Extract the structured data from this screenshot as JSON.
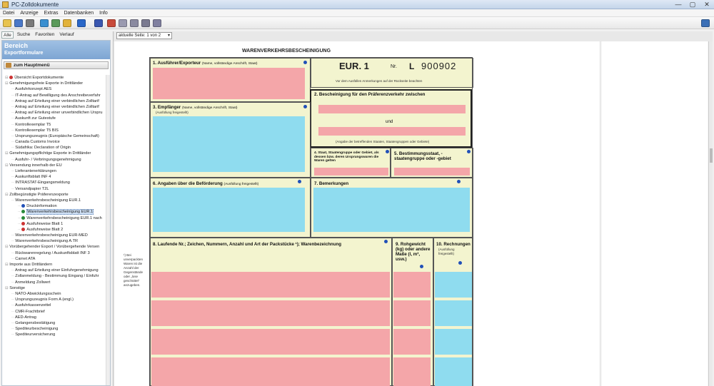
{
  "window": {
    "title": "PC-Zolldokumente",
    "controls": [
      "—",
      "▢",
      "✕"
    ]
  },
  "menu": [
    "Datei",
    "Anzeige",
    "Extras",
    "Datenbanken",
    "Info"
  ],
  "toolbar": {
    "colors": [
      "#e8c34f",
      "#4a78c8",
      "#7a7a7a",
      "#3a8fd0",
      "#5a9a5a",
      "#e2b23a",
      "#2a67c8",
      "#3a57b0",
      "#c84a3a",
      "#9a9ab0",
      "#8a8aa0",
      "#7a7a90",
      "#8080a0"
    ],
    "right_icon": "#3a6fb6"
  },
  "left_tabs": [
    "Alle",
    "Suche",
    "Favoriten",
    "Verlauf"
  ],
  "sidebar": {
    "title": "Bereich",
    "subtitle": "Exportformulare",
    "home_button": "zum Hauptmenü",
    "tree": [
      {
        "level": 1,
        "text": "Übersicht Exportdokumente",
        "icon": "#c33"
      },
      {
        "level": 1,
        "text": "Genehmigungsfreie Exporte in Drittländer"
      },
      {
        "level": 2,
        "text": "Ausfuhrkonzept AES"
      },
      {
        "level": 2,
        "text": "IT-Antrag auf Bewilligung des Anschreibeverfahr"
      },
      {
        "level": 2,
        "text": "Antrag auf Erteilung einer verbindlichen Zolltarif"
      },
      {
        "level": 2,
        "text": "Antrag auf Erteilung einer verbindlichen Zolltarif"
      },
      {
        "level": 2,
        "text": "Antrag auf Erteilung einer unverbindlichen Urspru"
      },
      {
        "level": 2,
        "text": "Auskunft zur Gutestufe"
      },
      {
        "level": 2,
        "text": "Kontrollexemplar T5"
      },
      {
        "level": 2,
        "text": "Kontrollexemplar T5 BIS"
      },
      {
        "level": 2,
        "text": "Ursprungszeugnis (Europäische Gemeinschaft)"
      },
      {
        "level": 2,
        "text": "Canada Customs Invoice"
      },
      {
        "level": 2,
        "text": "Südafrika: Declaration of Origin"
      },
      {
        "level": 1,
        "text": "Genehmigungspflichtige Exporte in Drittländer"
      },
      {
        "level": 2,
        "text": "Ausfuhr- / Verbringungsgenehmigung"
      },
      {
        "level": 1,
        "text": "Versendung innerhalb der EU"
      },
      {
        "level": 2,
        "text": "Lieferantenerklärungen"
      },
      {
        "level": 2,
        "text": "Auskunftsblatt INF 4"
      },
      {
        "level": 2,
        "text": "INTRASTAT-Eingangsmeldung"
      },
      {
        "level": 2,
        "text": "Versandpapier T2L"
      },
      {
        "level": 1,
        "text": "Zollbegünstigte Präferenzexporte"
      },
      {
        "level": 2,
        "text": "Warenverkehrsbescheinigung EUR.1"
      },
      {
        "level": 3,
        "text": "Druckinformation",
        "icon": "#2150b8"
      },
      {
        "level": 3,
        "text": "Warenverkehrsbescheinigung EUR.1",
        "icon": "#2a8a3a",
        "selected": true
      },
      {
        "level": 3,
        "text": "Warenverkehrsbescheinigung EUR.1 nach",
        "icon": "#2a8a3a"
      },
      {
        "level": 3,
        "text": "Ausfuhrweise Blatt 1",
        "icon": "#c33"
      },
      {
        "level": 3,
        "text": "Ausfuhrweise Blatt 2",
        "icon": "#c33"
      },
      {
        "level": 2,
        "text": "Warenverkehrsbescheinigung EUR-MED"
      },
      {
        "level": 2,
        "text": "Warenverkehrsbescheinigung A.TR"
      },
      {
        "level": 1,
        "text": "Vorübergehender Export / Vorübergehende Versen"
      },
      {
        "level": 2,
        "text": "Rückwarenregelung / Auskunftsblatt INF 3"
      },
      {
        "level": 2,
        "text": "Carnet ATA"
      },
      {
        "level": 1,
        "text": "Importe aus Drittländern"
      },
      {
        "level": 2,
        "text": "Antrag auf Erteilung einer Einfuhrgenehmigung"
      },
      {
        "level": 2,
        "text": "Zollanmeldung - Bestimmung Eingang / Einfuhr"
      },
      {
        "level": 2,
        "text": "Anmeldung Zollwert"
      },
      {
        "level": 1,
        "text": "Sonstige"
      },
      {
        "level": 2,
        "text": "NATO-Abwicklungsschein"
      },
      {
        "level": 2,
        "text": "Ursprungszeugnis Form A (engl.)"
      },
      {
        "level": 2,
        "text": "Ausfuhrkassenzettel"
      },
      {
        "level": 2,
        "text": "CMR-Frachtbrief"
      },
      {
        "level": 2,
        "text": "AED-Antrag"
      },
      {
        "level": 2,
        "text": "Gelangensbestätigung"
      },
      {
        "level": 2,
        "text": "Spediteurbescheinigung"
      },
      {
        "level": 2,
        "text": "Spediteurversicherung"
      }
    ]
  },
  "page_select": {
    "value": "aktuelle Seite: 1 von 2",
    "arrow": "▾"
  },
  "form": {
    "title": "WARENVERKEHRSBESCHEINIGUNG",
    "cert_type": "EUR. 1",
    "nr_label": "Nr.",
    "serial_letter": "L",
    "serial_number": "900902",
    "note_before": "Vor dem Ausfüllen Anmerkungen auf der Rückseite beachten",
    "f1": {
      "label": "1. Ausführer/Exporteur",
      "hint": "(Name, vollständige Anschrift, Staat)"
    },
    "f2": {
      "label": "2. Bescheinigung für den Präferenzverkehr zwischen",
      "und": "und",
      "note": "(Angabe der betreffenden Staaten, Staatengruppen oder Gebiete)"
    },
    "f3": {
      "label": "3. Empfänger",
      "hint": "(Name, vollständige Anschrift, Staat)",
      "hint2": "(Ausfüllung freigestellt)"
    },
    "f4": {
      "label": "4. Staat, Staatengruppe oder Gebiet, als dessen bzw. deren Ursprungswaren die Waren gelten"
    },
    "f5": {
      "label": "5. Bestimmungsstaat, -staatengruppe oder -gebiet"
    },
    "f6": {
      "label": "6. Angaben über die Beförderung",
      "hint": "(Ausfüllung freigestellt)"
    },
    "f7": {
      "label": "7. Bemerkungen"
    },
    "f8": {
      "label": "8. Laufende Nr.; Zeichen, Nummern, Anzahl und Art der Packstücke ¹); Warenbezeichnung"
    },
    "f9": {
      "label": "9. Rohgewicht (kg) oder andere Maße (l, m³, usw.)"
    },
    "f10": {
      "label": "10. Rechnungen",
      "hint": "(Ausfüllung freigestellt)"
    },
    "side_note": "¹) Bei unverpackten Waren ist die Anzahl der Gegenstände oder „lose geschüttet“ anzugeben.",
    "colors": {
      "pink": "#f4a6a9",
      "blue": "#8fdcef",
      "paper": "#f3f4cf",
      "info": "#2150b8"
    }
  }
}
